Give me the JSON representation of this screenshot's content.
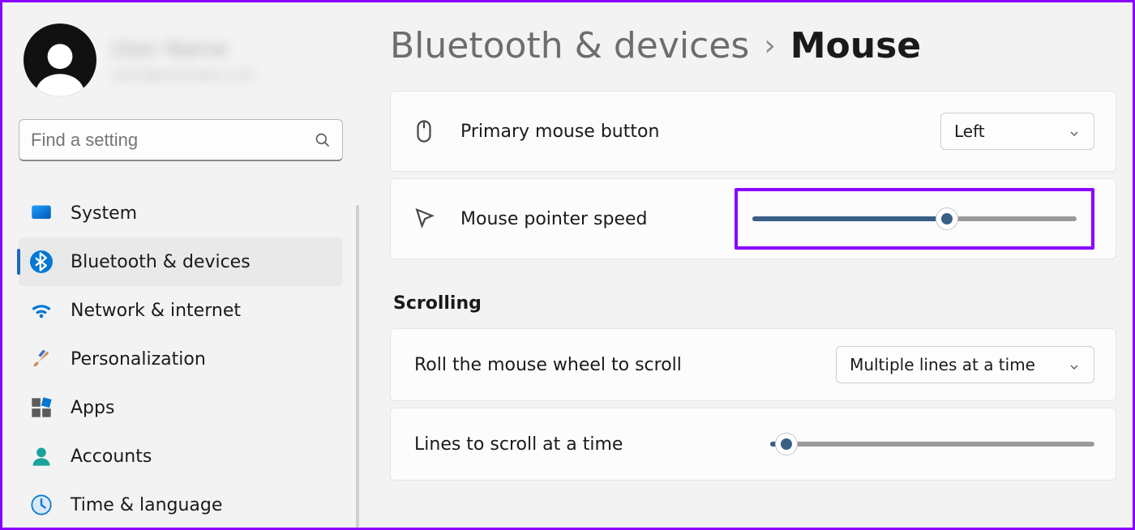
{
  "profile": {
    "name": "User Name",
    "sub": "user@example.com"
  },
  "search": {
    "placeholder": "Find a setting"
  },
  "nav": {
    "items": [
      {
        "label": "System"
      },
      {
        "label": "Bluetooth & devices"
      },
      {
        "label": "Network & internet"
      },
      {
        "label": "Personalization"
      },
      {
        "label": "Apps"
      },
      {
        "label": "Accounts"
      },
      {
        "label": "Time & language"
      }
    ],
    "active_index": 1
  },
  "breadcrumb": {
    "parent": "Bluetooth & devices",
    "sep": "›",
    "current": "Mouse"
  },
  "settings": {
    "primary_button": {
      "label": "Primary mouse button",
      "value": "Left"
    },
    "pointer_speed": {
      "label": "Mouse pointer speed",
      "percent": 60
    },
    "scrolling_heading": "Scrolling",
    "roll_wheel": {
      "label": "Roll the mouse wheel to scroll",
      "value": "Multiple lines at a time"
    },
    "lines_scroll": {
      "label": "Lines to scroll at a time",
      "percent": 5
    }
  }
}
